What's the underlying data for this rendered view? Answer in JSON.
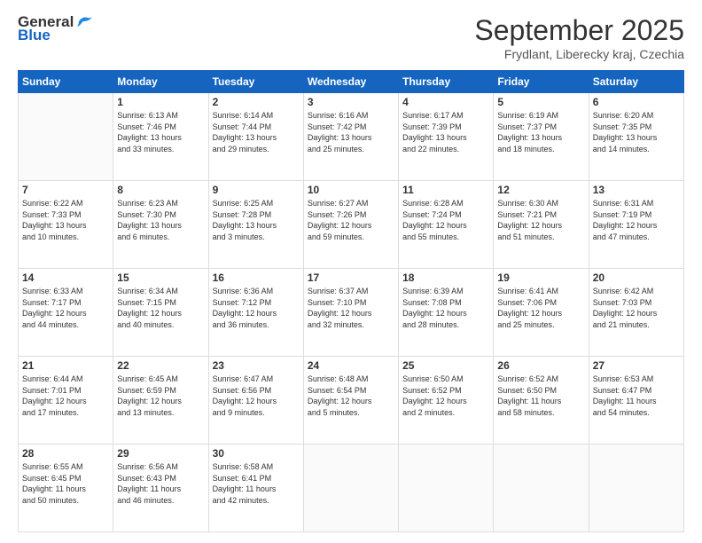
{
  "logo": {
    "general": "General",
    "blue": "Blue"
  },
  "header": {
    "month": "September 2025",
    "location": "Frydlant, Liberecky kraj, Czechia"
  },
  "weekdays": [
    "Sunday",
    "Monday",
    "Tuesday",
    "Wednesday",
    "Thursday",
    "Friday",
    "Saturday"
  ],
  "weeks": [
    [
      {
        "day": "",
        "content": ""
      },
      {
        "day": "1",
        "content": "Sunrise: 6:13 AM\nSunset: 7:46 PM\nDaylight: 13 hours\nand 33 minutes."
      },
      {
        "day": "2",
        "content": "Sunrise: 6:14 AM\nSunset: 7:44 PM\nDaylight: 13 hours\nand 29 minutes."
      },
      {
        "day": "3",
        "content": "Sunrise: 6:16 AM\nSunset: 7:42 PM\nDaylight: 13 hours\nand 25 minutes."
      },
      {
        "day": "4",
        "content": "Sunrise: 6:17 AM\nSunset: 7:39 PM\nDaylight: 13 hours\nand 22 minutes."
      },
      {
        "day": "5",
        "content": "Sunrise: 6:19 AM\nSunset: 7:37 PM\nDaylight: 13 hours\nand 18 minutes."
      },
      {
        "day": "6",
        "content": "Sunrise: 6:20 AM\nSunset: 7:35 PM\nDaylight: 13 hours\nand 14 minutes."
      }
    ],
    [
      {
        "day": "7",
        "content": "Sunrise: 6:22 AM\nSunset: 7:33 PM\nDaylight: 13 hours\nand 10 minutes."
      },
      {
        "day": "8",
        "content": "Sunrise: 6:23 AM\nSunset: 7:30 PM\nDaylight: 13 hours\nand 6 minutes."
      },
      {
        "day": "9",
        "content": "Sunrise: 6:25 AM\nSunset: 7:28 PM\nDaylight: 13 hours\nand 3 minutes."
      },
      {
        "day": "10",
        "content": "Sunrise: 6:27 AM\nSunset: 7:26 PM\nDaylight: 12 hours\nand 59 minutes."
      },
      {
        "day": "11",
        "content": "Sunrise: 6:28 AM\nSunset: 7:24 PM\nDaylight: 12 hours\nand 55 minutes."
      },
      {
        "day": "12",
        "content": "Sunrise: 6:30 AM\nSunset: 7:21 PM\nDaylight: 12 hours\nand 51 minutes."
      },
      {
        "day": "13",
        "content": "Sunrise: 6:31 AM\nSunset: 7:19 PM\nDaylight: 12 hours\nand 47 minutes."
      }
    ],
    [
      {
        "day": "14",
        "content": "Sunrise: 6:33 AM\nSunset: 7:17 PM\nDaylight: 12 hours\nand 44 minutes."
      },
      {
        "day": "15",
        "content": "Sunrise: 6:34 AM\nSunset: 7:15 PM\nDaylight: 12 hours\nand 40 minutes."
      },
      {
        "day": "16",
        "content": "Sunrise: 6:36 AM\nSunset: 7:12 PM\nDaylight: 12 hours\nand 36 minutes."
      },
      {
        "day": "17",
        "content": "Sunrise: 6:37 AM\nSunset: 7:10 PM\nDaylight: 12 hours\nand 32 minutes."
      },
      {
        "day": "18",
        "content": "Sunrise: 6:39 AM\nSunset: 7:08 PM\nDaylight: 12 hours\nand 28 minutes."
      },
      {
        "day": "19",
        "content": "Sunrise: 6:41 AM\nSunset: 7:06 PM\nDaylight: 12 hours\nand 25 minutes."
      },
      {
        "day": "20",
        "content": "Sunrise: 6:42 AM\nSunset: 7:03 PM\nDaylight: 12 hours\nand 21 minutes."
      }
    ],
    [
      {
        "day": "21",
        "content": "Sunrise: 6:44 AM\nSunset: 7:01 PM\nDaylight: 12 hours\nand 17 minutes."
      },
      {
        "day": "22",
        "content": "Sunrise: 6:45 AM\nSunset: 6:59 PM\nDaylight: 12 hours\nand 13 minutes."
      },
      {
        "day": "23",
        "content": "Sunrise: 6:47 AM\nSunset: 6:56 PM\nDaylight: 12 hours\nand 9 minutes."
      },
      {
        "day": "24",
        "content": "Sunrise: 6:48 AM\nSunset: 6:54 PM\nDaylight: 12 hours\nand 5 minutes."
      },
      {
        "day": "25",
        "content": "Sunrise: 6:50 AM\nSunset: 6:52 PM\nDaylight: 12 hours\nand 2 minutes."
      },
      {
        "day": "26",
        "content": "Sunrise: 6:52 AM\nSunset: 6:50 PM\nDaylight: 11 hours\nand 58 minutes."
      },
      {
        "day": "27",
        "content": "Sunrise: 6:53 AM\nSunset: 6:47 PM\nDaylight: 11 hours\nand 54 minutes."
      }
    ],
    [
      {
        "day": "28",
        "content": "Sunrise: 6:55 AM\nSunset: 6:45 PM\nDaylight: 11 hours\nand 50 minutes."
      },
      {
        "day": "29",
        "content": "Sunrise: 6:56 AM\nSunset: 6:43 PM\nDaylight: 11 hours\nand 46 minutes."
      },
      {
        "day": "30",
        "content": "Sunrise: 6:58 AM\nSunset: 6:41 PM\nDaylight: 11 hours\nand 42 minutes."
      },
      {
        "day": "",
        "content": ""
      },
      {
        "day": "",
        "content": ""
      },
      {
        "day": "",
        "content": ""
      },
      {
        "day": "",
        "content": ""
      }
    ]
  ]
}
